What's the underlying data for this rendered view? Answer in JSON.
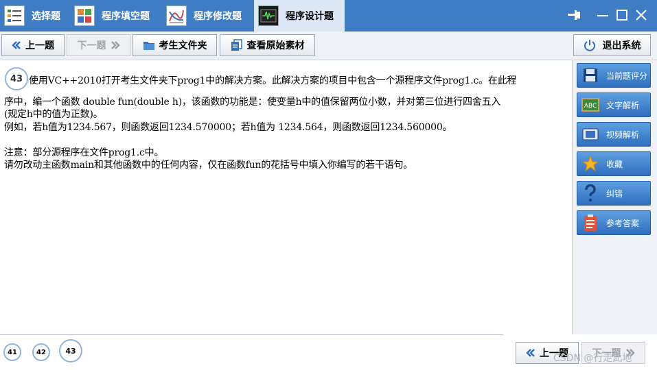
{
  "tabs": [
    {
      "label": "选择题",
      "icon": "checklist-icon",
      "active": false
    },
    {
      "label": "程序填空题",
      "icon": "grid-blocks-icon",
      "active": false
    },
    {
      "label": "程序修改题",
      "icon": "curve-chart-icon",
      "active": false
    },
    {
      "label": "程序设计题",
      "icon": "oscilloscope-icon",
      "active": true
    }
  ],
  "window_controls": [
    "pin-icon",
    "minimize-icon",
    "maximize-icon",
    "close-icon"
  ],
  "toolbar": {
    "prev_label": "上一题",
    "next_label": "下一题",
    "folder_label": "考生文件夹",
    "material_label": "查看原始素材",
    "exit_label": "退出系统"
  },
  "question": {
    "number": "43",
    "line1": "使用VC++2010打开考生文件夹下prog1中的解决方案。此解决方案的项目中包含一个源程序文件prog1.c。在此程",
    "line2": "序中，编一个函数 double fun(double h)，该函数的功能是：使变量h中的值保留两位小数，并对第三位进行四舍五入",
    "line3": "(规定h中的值为正数)。",
    "line4": "例如，若h值为1234.567，则函数返回1234.570000；若h值为 1234.564，则函数返回1234.560000。",
    "line5": "注意：部分源程序在文件prog1.c中。",
    "line6": "请勿改动主函数main和其他函数中的任何内容，仅在函数fun的花括号中填入你编写的若干语句。"
  },
  "side_buttons": [
    {
      "label": "当前题评分",
      "icon": "floppy-disk-icon"
    },
    {
      "label": "文字解析",
      "icon": "abc-board-icon"
    },
    {
      "label": "视频解析",
      "icon": "film-icon"
    },
    {
      "label": "收藏",
      "icon": "star-icon"
    },
    {
      "label": "纠错",
      "icon": "question-mark-icon"
    },
    {
      "label": "参考答案",
      "icon": "clipboard-icon"
    }
  ],
  "bottom": {
    "question_numbers": [
      "41",
      "42",
      "43"
    ],
    "current": "43",
    "prev_label": "上一题",
    "next_label": "下一题",
    "watermark": "CSDN @行走此地"
  },
  "colors": {
    "titlebar": "#3e7cc4",
    "active_tab": "#dce8f6",
    "side_button": "#3a7dcc",
    "circle_border": "#8fb3d9"
  }
}
